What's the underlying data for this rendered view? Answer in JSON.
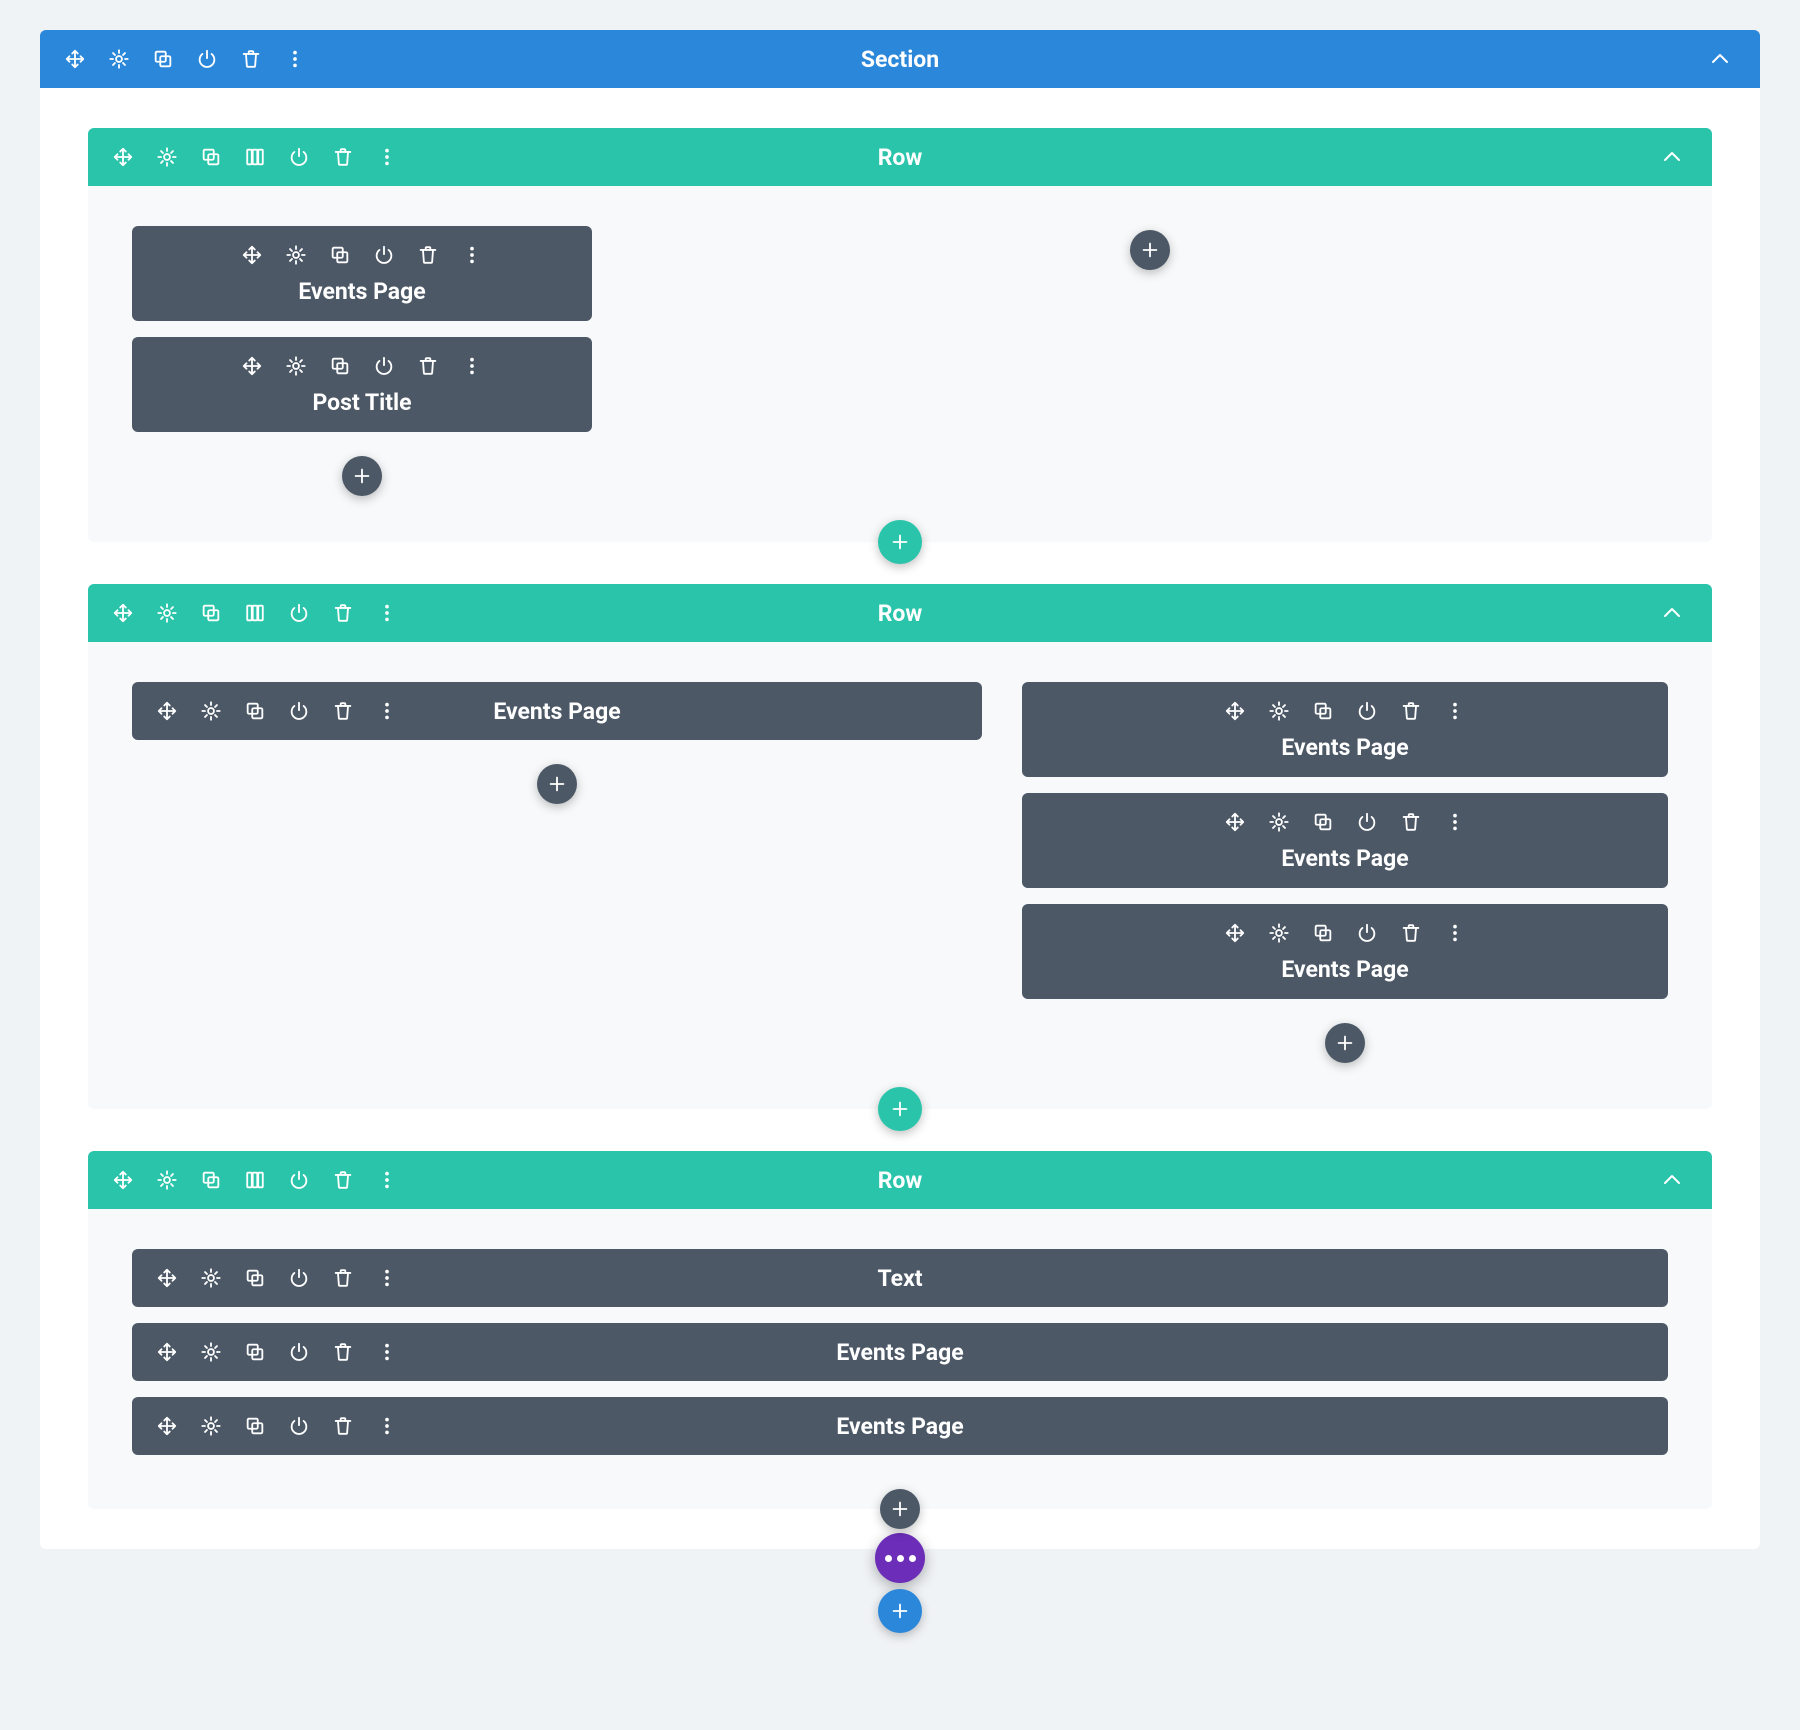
{
  "colors": {
    "section": "#2b87da",
    "row": "#29c4a9",
    "module": "#4c5866",
    "fab": "#6c2eb9"
  },
  "section": {
    "title": "Section",
    "rows": [
      {
        "title": "Row",
        "layout": "two-col-narrow-left",
        "columns": [
          {
            "modules": [
              {
                "label": "Events Page"
              },
              {
                "label": "Post Title"
              }
            ]
          },
          {
            "modules": []
          }
        ]
      },
      {
        "title": "Row",
        "layout": "two-col-wide-left",
        "columns": [
          {
            "modules": [
              {
                "label": "Events Page"
              }
            ]
          },
          {
            "modules": [
              {
                "label": "Events Page"
              },
              {
                "label": "Events Page"
              },
              {
                "label": "Events Page"
              }
            ]
          }
        ]
      },
      {
        "title": "Row",
        "layout": "single",
        "columns": [
          {
            "modules": [
              {
                "label": "Text"
              },
              {
                "label": "Events Page"
              },
              {
                "label": "Events Page"
              }
            ]
          }
        ]
      }
    ]
  }
}
